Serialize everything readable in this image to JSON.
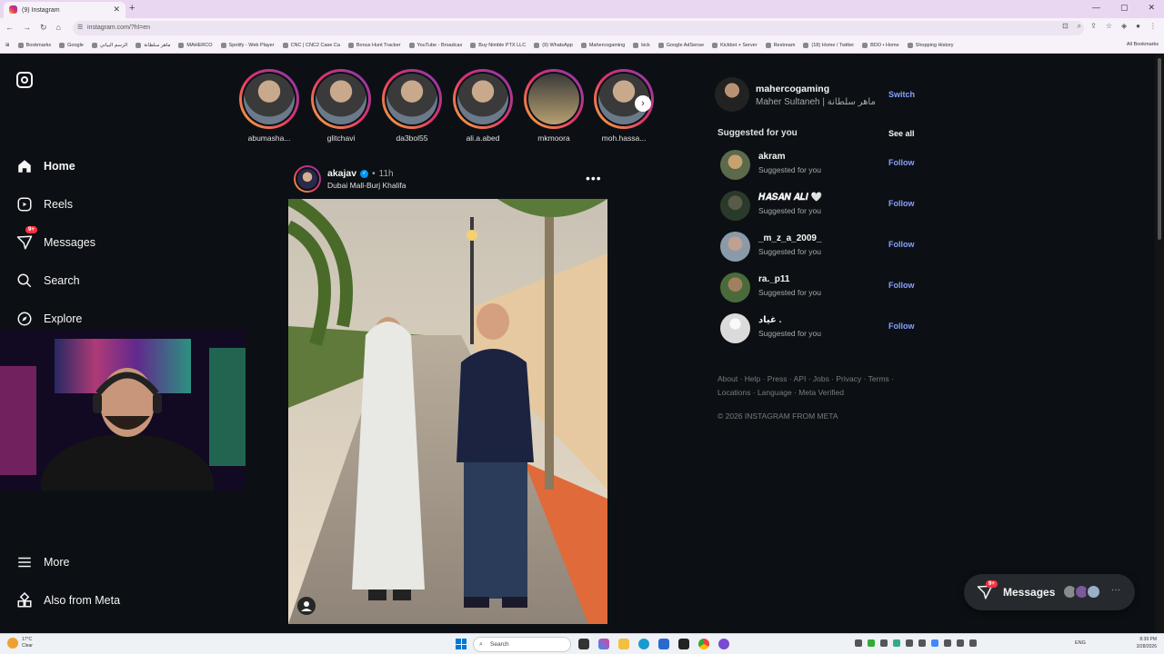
{
  "browser": {
    "tab_title": "(9) Instagram",
    "url": "instagram.com/?hl=en",
    "bookmarks": [
      "Bookmarks",
      "Google",
      "الرسم البياني",
      "ماهر سلطانة",
      "MAHERCO",
      "Spotify - Web Player",
      "CNC | CNC2 Case Ca",
      "Bonus Hunt Tracker",
      "YouTube - Broadcas",
      "Buy Nimble PTX LLC",
      "(9) WhatsApp",
      "Mahercogaming",
      "kick",
      "Google AdSense",
      "Kickbot + Server",
      "Restream",
      "(18) Home / Twitter",
      "BDO • Home",
      "Shopping History"
    ],
    "all_bookmarks": "All Bookmarks"
  },
  "sidebar": {
    "items": [
      {
        "label": "Home",
        "icon": "home-icon"
      },
      {
        "label": "Reels",
        "icon": "reels-icon"
      },
      {
        "label": "Messages",
        "icon": "messages-icon",
        "badge": "9+"
      },
      {
        "label": "Search",
        "icon": "search-icon"
      },
      {
        "label": "Explore",
        "icon": "explore-icon"
      }
    ],
    "bottom_items": [
      {
        "label": "More",
        "icon": "menu-icon"
      },
      {
        "label": "Also from Meta",
        "icon": "meta-apps-icon"
      }
    ]
  },
  "stories": [
    "abumasha...",
    "glitchavi",
    "da3bol55",
    "ali.a.abed",
    "mkmoora",
    "moh.hassa..."
  ],
  "post": {
    "username": "akajav",
    "time": "11h",
    "location": "Dubai Mall-Burj Khalifa"
  },
  "account": {
    "username": "mahercogaming",
    "fullname": "Maher Sultaneh | ماهر سلطانة",
    "switch_label": "Switch"
  },
  "suggestions": {
    "title": "Suggested for you",
    "see_all": "See all",
    "follow_label": "Follow",
    "subtitle": "Suggested for you",
    "users": [
      "akram",
      "𝑯𝑨𝑺𝑨𝑵 𝑨𝑳𝑰 🤍",
      "_m_z_a_2009_",
      "ra._p11",
      "غياد ."
    ]
  },
  "footer": {
    "links": "About · Help · Press · API · Jobs · Privacy · Terms · Locations · Language · Meta Verified",
    "copyright": "© 2026 INSTAGRAM FROM META"
  },
  "messages_pill": {
    "label": "Messages",
    "badge": "9+"
  },
  "taskbar": {
    "weather_temp": "17°C",
    "weather_desc": "Clear",
    "search_placeholder": "Search",
    "lang": "ENG",
    "time": "8:39 PM",
    "date": "3/28/2026"
  },
  "colors": {
    "background": "#0c1014",
    "link_blue": "#85a1ff",
    "badge_red": "#ff3040",
    "story_ring": "#e1306c"
  }
}
